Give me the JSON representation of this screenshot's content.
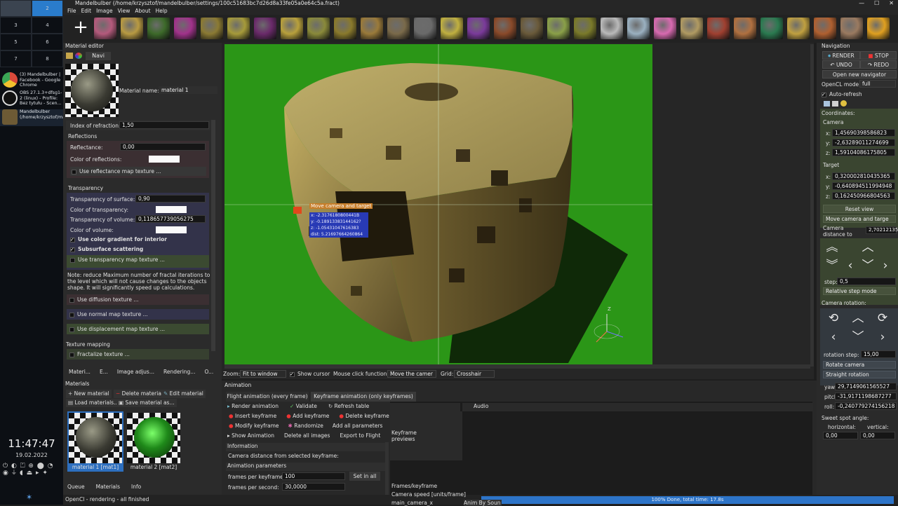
{
  "taskbar": {
    "workspaces": [
      "",
      "2",
      "3",
      "4",
      "5",
      "6",
      "7",
      "8"
    ],
    "tasks": [
      {
        "label": "(3) Mandelbulber | Facebook - Google Chrome",
        "color": "#d94a3a"
      },
      {
        "label": "OBS 27.1.3+dfsg1-2 (linux) - Profile: Bez tytułu - Scen...",
        "color": "#2a2a2a"
      },
      {
        "label": "Mandelbulber (/home/krzysztof/mandelbulber/se...",
        "color": "#6d5a35"
      }
    ],
    "clock": "11:47:47",
    "date": "19.02.2022",
    "tray": "⏻ ◐ ⏍ ⊕ ⬤ ◔ ◉ ⏚ ◖ ⏏ ▸ ✦"
  },
  "window": {
    "title": "Mandelbulber (/home/krzysztof/mandelbulber/settings/100c51683bc7d26d8a33fe05a0e64c5a.fract)",
    "controls": [
      "—",
      "☐",
      "✕"
    ]
  },
  "menu": [
    "File",
    "Edit",
    "Image",
    "View",
    "About",
    "Help"
  ],
  "toolbar": {
    "thumb_colors": [
      "#b45a7c",
      "#b89a42",
      "#3d6a2a",
      "#a1328b",
      "#8b7a33",
      "#a69a3a",
      "#6a2a6a",
      "#b8a03c",
      "#8a8a3a",
      "#8a7a2c",
      "#9a7a3a",
      "#7a6a4a",
      "#6a6a6a",
      "#c0b040",
      "#7a3a9a",
      "#8a4a2a",
      "#6a5a3a",
      "#8aa048",
      "#7a7a2a",
      "#bababa",
      "#9ab0c0",
      "#d86ab0",
      "#b09a62",
      "#a04030",
      "#b07040",
      "#2a7a50",
      "#c0a040",
      "#b06030",
      "#9a7a60",
      "#e0a020"
    ]
  },
  "material_editor": {
    "title": "Material editor",
    "tab_navi": "Navi",
    "material_name_label": "Material name:",
    "material_name": "material 1",
    "index_of_refraction_label": "Index of refraction:",
    "index_of_refraction": "1,50",
    "reflections_header": "Reflections",
    "reflectance_label": "Reflectance:",
    "reflectance": "0,00",
    "color_of_reflections_label": "Color of reflections:",
    "use_reflectance_map": "Use reflectance map texture ...",
    "transparency_header": "Transparency",
    "transparency_of_surface_label": "Transparency of surface:",
    "transparency_of_surface": "0,90",
    "color_of_transparency_label": "Color of transparency:",
    "transparency_of_volume_label": "Transparency of volume:",
    "transparency_of_volume": "0,118657739056275",
    "color_of_volume_label": "Color of volume:",
    "use_color_gradient": "Use color gradient for interior",
    "subsurface_scattering": "Subsurface scattering",
    "use_transparency_map": "Use transparency map texture ...",
    "note": "Note: reduce Maximum number of fractal iterations to the level which will not cause changes to the objects shape. It will significantly speed up calculations.",
    "use_diffusion": "Use diffusion texture ...",
    "use_normal_map": "Use normal map texture ...",
    "use_displacement_map": "Use displacement map texture ...",
    "texture_mapping_header": "Texture mapping",
    "fractalize_texture": "Fractalize texture ...",
    "bottom_tabs": [
      "Materi...",
      "E...",
      "Image adjus...",
      "Rendering...",
      "O..."
    ]
  },
  "materials": {
    "title": "Materials",
    "new_material": "New material",
    "delete_material": "Delete material",
    "edit_material": "Edit material",
    "load_materials": "Load materials...",
    "save_material_as": "Save material as...",
    "items": [
      "material 1 [mat1]",
      "material 2 [mat2]"
    ],
    "bottom_tabs": [
      "Queue",
      "Materials",
      "Info"
    ]
  },
  "status": "OpenCl - rendering - all finished",
  "viewport": {
    "tooltip_title": "Move camera and target",
    "tooltip_lines": [
      "x: -2.3176180800441B",
      "y: -0.18913383144162?",
      "z: -1.05431047616383",
      "dist: 5.21697664260864"
    ],
    "axis_label": "Z"
  },
  "viewport_bar": {
    "zoom_label": "Zoom:",
    "zoom_value": "Fit to window",
    "show_cursor": "Show cursor",
    "mouse_click_label": "Mouse click function:",
    "mouse_click_value": "Move the camer",
    "grid_label": "Grid:",
    "grid_value": "Crosshair"
  },
  "animation": {
    "title": "Animation",
    "tab_flight": "Flight animation (every frame)",
    "tab_keyframe": "Keyframe animation (only keyframes)",
    "render_animation": "Render animation",
    "validate": "Validate",
    "refresh_table": "Refresh table",
    "insert_keyframe": "Insert keyframe",
    "add_keyframe": "Add keyframe",
    "delete_keyframe": "Delete keyframe",
    "modify_keyframe": "Modify keyframe",
    "randomize": "Randomize",
    "add_all_parameters": "Add all parameters",
    "show_animation": "Show Animation",
    "delete_all_images": "Delete all images",
    "export_to_flight": "Export to Flight",
    "information": "Information",
    "camera_distance_from_keyframe": "Camera distance from selected keyframe:",
    "animation_parameters": "Animation parameters",
    "frames_per_keyframe_label": "frames per keyframe:",
    "frames_per_keyframe": "100",
    "set_in_all": "Set in all",
    "frames_per_second_label": "frames per second:",
    "frames_per_second": "30,0000",
    "table_audio": "Audio",
    "table_keyframe_previews": "Keyframe previews",
    "table_frames_keyframe": "Frames/keyframe",
    "table_camera_speed": "Camera speed [units/frame]",
    "table_main_camera_x": "main_camera_x",
    "anim_by_sound": "Anim By Soun"
  },
  "progress": {
    "text": "100% Done, total time: 17.8s",
    "fraction": 1.0
  },
  "navigation": {
    "title": "Navigation",
    "render": "RENDER",
    "stop": "STOP",
    "undo": "UNDO",
    "redo": "REDO",
    "open_new_navigator": "Open new navigator",
    "opencl_mode_label": "OpenCL mode:",
    "opencl_mode": "full",
    "auto_refresh": "Auto-refresh",
    "coordinates_label": "Coordinates:",
    "camera_label": "Camera",
    "camera_x": "1,45690398586823",
    "camera_y": "-2,63289011274699",
    "camera_z": "1,59104086175805",
    "target_label": "Target",
    "target_x": "0,320002810435365",
    "target_y": "-0,640894511994948",
    "target_z": "0,162450966804563",
    "reset_view": "Reset view",
    "move_mode": "Move camera and targe",
    "camera_distance_label": "Camera distance to target:",
    "camera_distance": "2,702121354",
    "step_label": "step:",
    "step": "0,5",
    "step_mode": "Relative step mode",
    "camera_rotation_label": "Camera rotation:",
    "rotation_step_label": "rotation step:",
    "rotation_step": "15,00",
    "rotate_camera": "Rotate camera",
    "straight_rotation": "Straight rotation",
    "yaw_label": "yaw:",
    "yaw": "29,7149061565527",
    "pitch_label": "pitch:",
    "pitch": "-31,9171198687277",
    "roll_label": "roll:",
    "roll": "-0,240779274156218",
    "sweet_spot_label": "Sweet spot angle:",
    "horizontal_label": "horizontal:",
    "horizontal": "0,00",
    "vertical_label": "vertical:",
    "vertical": "0,00"
  }
}
